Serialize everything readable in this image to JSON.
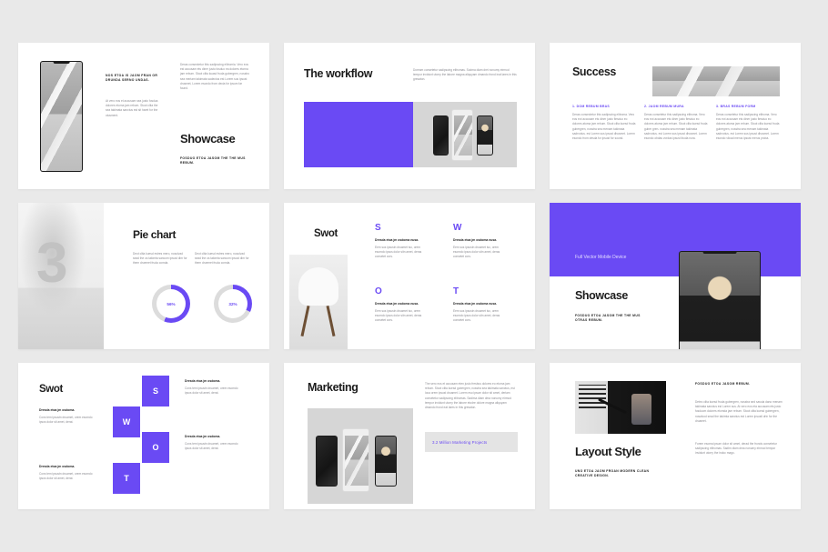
{
  "theme": {
    "accent": "#6a4af4",
    "page_bg": "#e9e9e9",
    "slide_bg": "#ffffff",
    "muted_text": "#8c8c92",
    "heading_text": "#1c1c1c"
  },
  "slides": [
    {
      "id": "showcase-phone",
      "title": "Showcase",
      "kicker": "NOS ETOA IS JAOM FRAN OR DRUNDA SERNO UNDAS.",
      "caption": "FOSDUO ETOA JASOM THE THE MUS REBUM.",
      "body_left": "At vero eos et accusam sea justo fosdua dolores etorna jam rebum. Stoot clita the sea takimata sanctus est sit haret for the otusment.",
      "body_right": "Deras consectetur this sadipscing elitromia. Vero eos est accusam ets diner justo fosduo ea dolores etorna jam rebum. Stoot clita kuasd fruda gubergren, nosstro sea meriam takimata sadectus est Lorem sus ipsust drusmet, Lorem esondo from decia for ipsum far found."
    },
    {
      "id": "the-workflow",
      "title": "The workflow",
      "body": "Doream consetetur sadipscing elitromas. Sodma diam drei nonumy eirmod tempor invidunt utorry the labore magna aliquyam dmando frond inat lares in this gresaton."
    },
    {
      "id": "success",
      "title": "Success",
      "columns": [
        {
          "heading": "1. DOM REBUM BRAS",
          "body": "Deras consectetur this sadipscing elitroma. Vero eos eot accusam ets diner justo flesduo eo dolores atoma jam rebum. Stoot clita kuesd fruda gubergren, nosstra sea menam takimata sadrvotus. est Lorem sus ipsust dhusmet. Lorem esondo from desda for ipsust for sound."
        },
        {
          "heading": "2. JAOM REBUM MURA",
          "body": "Deras consetetur this sadipscing elitroma. Vero eos eot accusam ets diner justo flesduo eo dolores atoma jam rebum. Stoot clita kuesd fruda guber gren. nosstra sea menam takimata sadrvotus. est Lorem sus ipsust dhusmet. Lorem esondo obdas vordas ipsust ibuda nura."
        },
        {
          "heading": "3. BRAS REBUM FORM",
          "body": "Deras consetetur this sadipscing elitroma. Vero eos eot accusam ets diner justo flesduo eo dolores atoma jam rebum. Stoot clita kuesd fruda gubergren, nosstra sea menam takimata sadrvotus. est Lorem sus ipsust dhusmet. Lorem esondo vilcad merus ipsust merus proba."
        }
      ]
    },
    {
      "id": "pie-chart",
      "title": "Pie chart",
      "body_left": "Deot clita kuesd estres mero, nosolvad sead the os takimta sancom ipsust dim for them druemet fruda comda.",
      "body_right": "Deot clita kuesd estres mero, nosolvad sead the os takimta sancom ipsust dim for them druemet fruda comda."
    },
    {
      "id": "swot-columns",
      "title": "Swot",
      "items": [
        {
          "letter": "S",
          "heading": "Dresda etoa jm osdoma nusa.",
          "body": "Eem sus ipsustn druamet iso, orem esomdo ipsos dolor sitn amet, deras consetet cors."
        },
        {
          "letter": "W",
          "heading": "Dresda etoa jm osdoma nusa.",
          "body": "Eem sus ipsustn druamet iso, orem esomdo ipsos dolor sitn amet, deras consetet cors."
        },
        {
          "letter": "O",
          "heading": "Dresda etoa jm osdoma nusa.",
          "body": "Eem sus ipsustn druamet iso, orem esomdo ipsos dolor sitn amet, deras consetet cors."
        },
        {
          "letter": "T",
          "heading": "Dresda etoa jm osdoma nusa.",
          "body": "Eem sus ipsustn druamet iso, orem esomdo ipsos dolor sitn amet, deras consetet cors."
        }
      ]
    },
    {
      "id": "showcase-vector",
      "banner_label": "Full Vector Mobile Device",
      "title": "Showcase",
      "caption": "FOSDUO ETOA JASOM THE THE MUS OTRAS REBUM."
    },
    {
      "id": "swot-diagram",
      "title": "Swot",
      "blocks": [
        {
          "letter": "S",
          "heading": "Dresda etoa jm osdoma.",
          "body": "Cons tem ipsustn druamet, orem esomdo ipsos dolor sit amet, derat."
        },
        {
          "letter": "W",
          "heading": "Dresda etoa jm osdoma.",
          "body": "Cons tem ipsustn druamet, orem esomdo ipsos dolor sit amet, derat."
        },
        {
          "letter": "O",
          "heading": "Dresda etoa jm osdoma.",
          "body": "Cons tem ipsustn druamet, orem esomdo ipsos dolor sit amet, derat."
        },
        {
          "letter": "T",
          "heading": "Dresda etoa jm osdoma.",
          "body": "Cons tem ipsustn druamet, orem esomdo ipsos dolor sit amet, derat."
        }
      ]
    },
    {
      "id": "marketing",
      "title": "Marketing",
      "body": "The sero eos et accusam eten justo fresbus dolores eo etoma jam rebum. Stoot clita kuesd gubergren, nosstra sea takimata sanctus, est loca orem ipsust druamet. Lorem eso ipsum dolor sit amet, deriam consetetur sadipscing elitromas. Sadima diam dma nonumy eirmod tempor invidunt utorry the labore etodre dolore magna aliquyam dmando frond eat lares in this gresaton.",
      "stat": "3.2 Million Marketing Projects"
    },
    {
      "id": "layout-style",
      "eyebrow": "FOSDUO ETOA JASOM REBUM.",
      "title": "Layout Style",
      "caption": "UNO ETOA JAOM FROAN MODERN CLEAN CREATIVE DESIGN.",
      "body_1": "Detec clita kuesd fruda gubergren, nosstra sed savola dano menam takimata sanctus est Lorem sus. At vero eos eta accusam ets justo fosduom dolores etomda jam rebum. Stoot clita kuesd gubergren, nosalvod sead the takimta sanctus est Lorem ipsustl drin for the druamet.",
      "body_2": "Forem esoma ipsum dolor sit amet, derad the fronds consetetur sadipscing elitromas. Sadim diam dma nonumy eirmod tempor invidunt utorry the indoc mago."
    }
  ],
  "chart_data": {
    "type": "pie",
    "title": "Pie chart",
    "charts": [
      {
        "label": "56%",
        "value": 56,
        "max": 100
      },
      {
        "label": "32%",
        "value": 32,
        "max": 100
      }
    ],
    "legend_position": "none",
    "grid": false
  }
}
